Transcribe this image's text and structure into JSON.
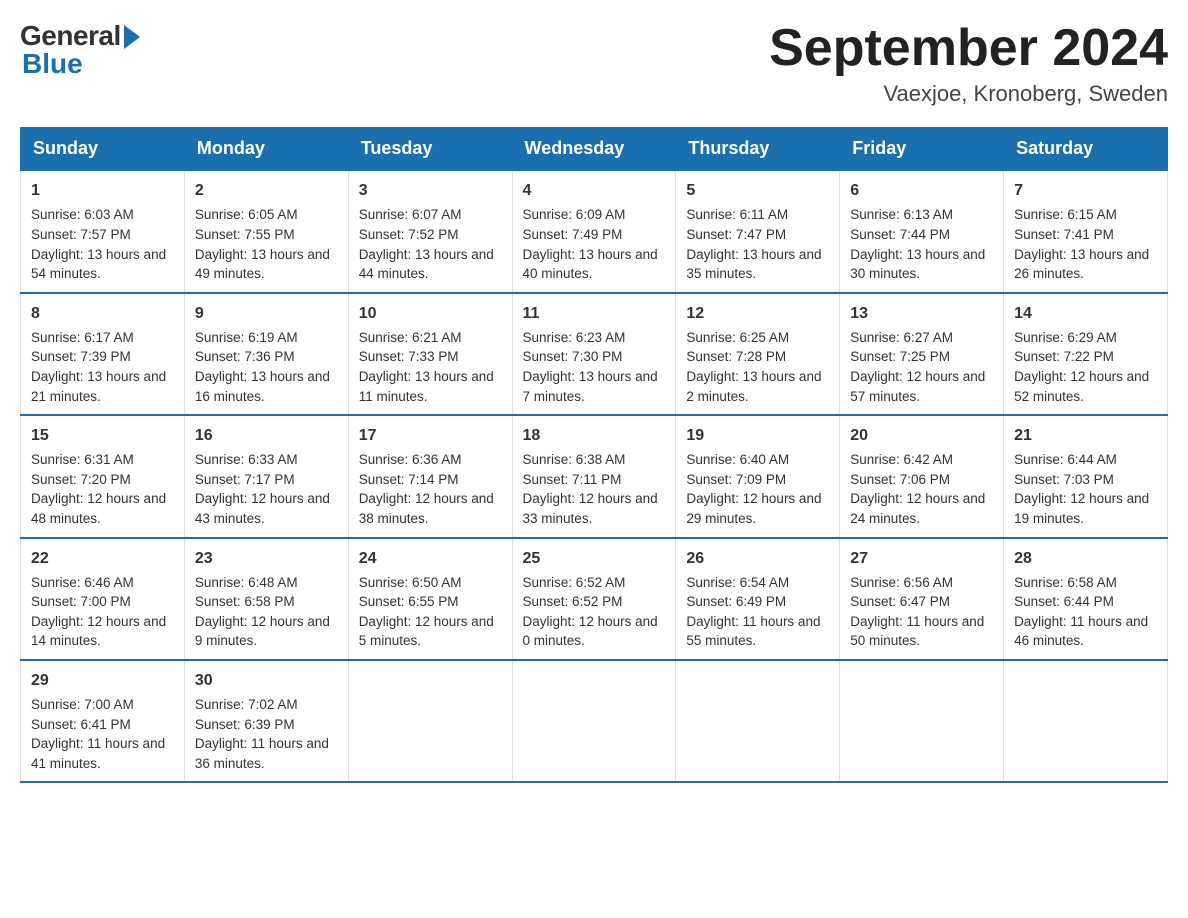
{
  "header": {
    "logo_general": "General",
    "logo_blue": "Blue",
    "month_title": "September 2024",
    "location": "Vaexjoe, Kronoberg, Sweden"
  },
  "days_of_week": [
    "Sunday",
    "Monday",
    "Tuesday",
    "Wednesday",
    "Thursday",
    "Friday",
    "Saturday"
  ],
  "weeks": [
    [
      {
        "day": "1",
        "sunrise": "6:03 AM",
        "sunset": "7:57 PM",
        "daylight": "13 hours and 54 minutes."
      },
      {
        "day": "2",
        "sunrise": "6:05 AM",
        "sunset": "7:55 PM",
        "daylight": "13 hours and 49 minutes."
      },
      {
        "day": "3",
        "sunrise": "6:07 AM",
        "sunset": "7:52 PM",
        "daylight": "13 hours and 44 minutes."
      },
      {
        "day": "4",
        "sunrise": "6:09 AM",
        "sunset": "7:49 PM",
        "daylight": "13 hours and 40 minutes."
      },
      {
        "day": "5",
        "sunrise": "6:11 AM",
        "sunset": "7:47 PM",
        "daylight": "13 hours and 35 minutes."
      },
      {
        "day": "6",
        "sunrise": "6:13 AM",
        "sunset": "7:44 PM",
        "daylight": "13 hours and 30 minutes."
      },
      {
        "day": "7",
        "sunrise": "6:15 AM",
        "sunset": "7:41 PM",
        "daylight": "13 hours and 26 minutes."
      }
    ],
    [
      {
        "day": "8",
        "sunrise": "6:17 AM",
        "sunset": "7:39 PM",
        "daylight": "13 hours and 21 minutes."
      },
      {
        "day": "9",
        "sunrise": "6:19 AM",
        "sunset": "7:36 PM",
        "daylight": "13 hours and 16 minutes."
      },
      {
        "day": "10",
        "sunrise": "6:21 AM",
        "sunset": "7:33 PM",
        "daylight": "13 hours and 11 minutes."
      },
      {
        "day": "11",
        "sunrise": "6:23 AM",
        "sunset": "7:30 PM",
        "daylight": "13 hours and 7 minutes."
      },
      {
        "day": "12",
        "sunrise": "6:25 AM",
        "sunset": "7:28 PM",
        "daylight": "13 hours and 2 minutes."
      },
      {
        "day": "13",
        "sunrise": "6:27 AM",
        "sunset": "7:25 PM",
        "daylight": "12 hours and 57 minutes."
      },
      {
        "day": "14",
        "sunrise": "6:29 AM",
        "sunset": "7:22 PM",
        "daylight": "12 hours and 52 minutes."
      }
    ],
    [
      {
        "day": "15",
        "sunrise": "6:31 AM",
        "sunset": "7:20 PM",
        "daylight": "12 hours and 48 minutes."
      },
      {
        "day": "16",
        "sunrise": "6:33 AM",
        "sunset": "7:17 PM",
        "daylight": "12 hours and 43 minutes."
      },
      {
        "day": "17",
        "sunrise": "6:36 AM",
        "sunset": "7:14 PM",
        "daylight": "12 hours and 38 minutes."
      },
      {
        "day": "18",
        "sunrise": "6:38 AM",
        "sunset": "7:11 PM",
        "daylight": "12 hours and 33 minutes."
      },
      {
        "day": "19",
        "sunrise": "6:40 AM",
        "sunset": "7:09 PM",
        "daylight": "12 hours and 29 minutes."
      },
      {
        "day": "20",
        "sunrise": "6:42 AM",
        "sunset": "7:06 PM",
        "daylight": "12 hours and 24 minutes."
      },
      {
        "day": "21",
        "sunrise": "6:44 AM",
        "sunset": "7:03 PM",
        "daylight": "12 hours and 19 minutes."
      }
    ],
    [
      {
        "day": "22",
        "sunrise": "6:46 AM",
        "sunset": "7:00 PM",
        "daylight": "12 hours and 14 minutes."
      },
      {
        "day": "23",
        "sunrise": "6:48 AM",
        "sunset": "6:58 PM",
        "daylight": "12 hours and 9 minutes."
      },
      {
        "day": "24",
        "sunrise": "6:50 AM",
        "sunset": "6:55 PM",
        "daylight": "12 hours and 5 minutes."
      },
      {
        "day": "25",
        "sunrise": "6:52 AM",
        "sunset": "6:52 PM",
        "daylight": "12 hours and 0 minutes."
      },
      {
        "day": "26",
        "sunrise": "6:54 AM",
        "sunset": "6:49 PM",
        "daylight": "11 hours and 55 minutes."
      },
      {
        "day": "27",
        "sunrise": "6:56 AM",
        "sunset": "6:47 PM",
        "daylight": "11 hours and 50 minutes."
      },
      {
        "day": "28",
        "sunrise": "6:58 AM",
        "sunset": "6:44 PM",
        "daylight": "11 hours and 46 minutes."
      }
    ],
    [
      {
        "day": "29",
        "sunrise": "7:00 AM",
        "sunset": "6:41 PM",
        "daylight": "11 hours and 41 minutes."
      },
      {
        "day": "30",
        "sunrise": "7:02 AM",
        "sunset": "6:39 PM",
        "daylight": "11 hours and 36 minutes."
      },
      null,
      null,
      null,
      null,
      null
    ]
  ],
  "labels": {
    "sunrise": "Sunrise:",
    "sunset": "Sunset:",
    "daylight": "Daylight:"
  }
}
